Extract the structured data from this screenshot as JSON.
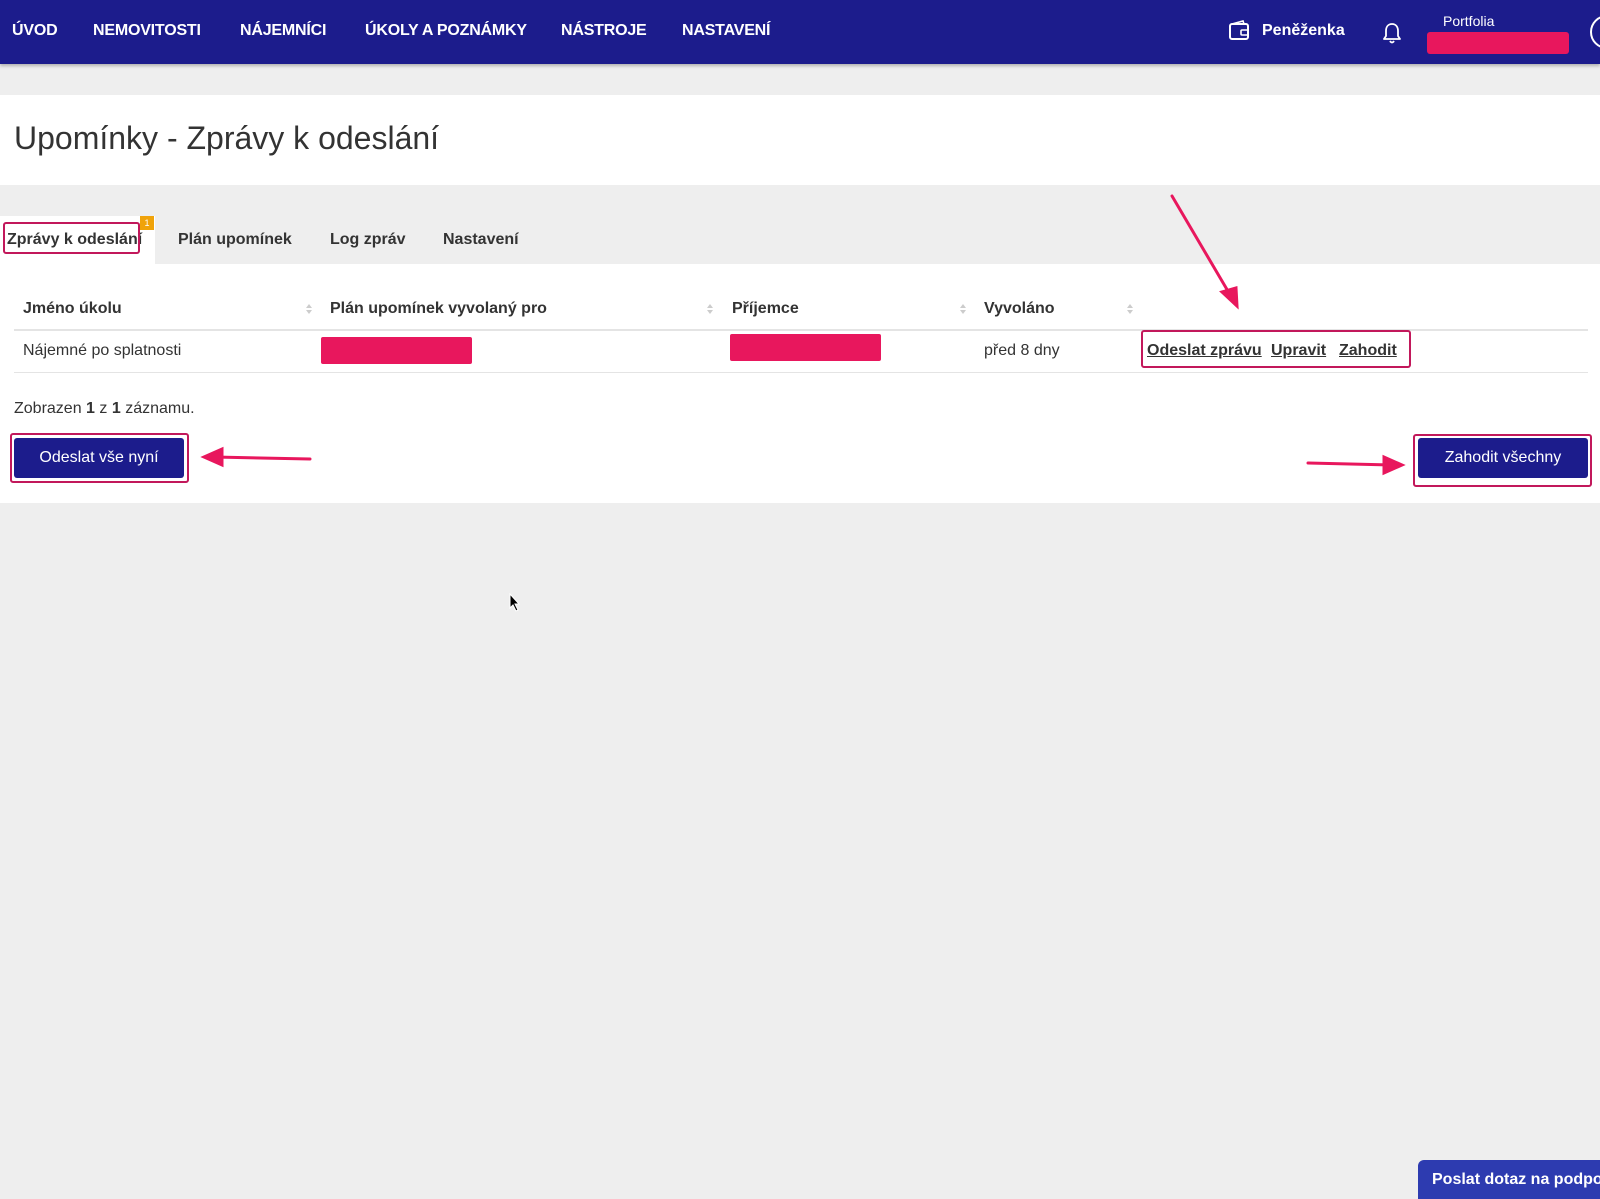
{
  "nav": {
    "items": [
      "ÚVOD",
      "NEMOVITOSTI",
      "NÁJEMNÍCI",
      "ÚKOLY A POZNÁMKY",
      "NÁSTROJE",
      "NASTAVENÍ"
    ],
    "wallet_label": "Peněženka",
    "portfolio_label": "Portfolia",
    "icons": {
      "wallet": "wallet-icon",
      "bell": "bell-icon",
      "avatar": "user-avatar-icon"
    }
  },
  "page": {
    "title": "Upomínky - Zprávy k odeslání"
  },
  "tabs": {
    "items": [
      "Zprávy k odeslání",
      "Plán upomínek",
      "Log zpráv",
      "Nastavení"
    ],
    "active_index": 0,
    "badge": "1"
  },
  "table": {
    "columns": [
      "Jméno úkolu",
      "Plán upomínek vyvolaný pro",
      "Příjemce",
      "Vyvoláno"
    ],
    "rows": [
      {
        "task_name": "Nájemné po splatnosti",
        "plan_for": "",
        "recipient": "",
        "triggered": "před 8 dny",
        "actions": [
          "Odeslat zprávu",
          "Upravit",
          "Zahodit"
        ]
      }
    ]
  },
  "summary": {
    "prefix": "Zobrazen",
    "from": "1",
    "mid": "z",
    "total": "1",
    "suffix": "záznamu."
  },
  "buttons": {
    "send_all": "Odeslat vše nyní",
    "discard_all": "Zahodit všechny"
  },
  "support": {
    "label": "Poslat dotaz na podporu"
  },
  "colors": {
    "nav_bg": "#1c1c8c",
    "accent": "#1c1c8c",
    "annotation": "#e8175d",
    "badge": "#f0a30a",
    "support_bg": "#2d3bb0"
  }
}
